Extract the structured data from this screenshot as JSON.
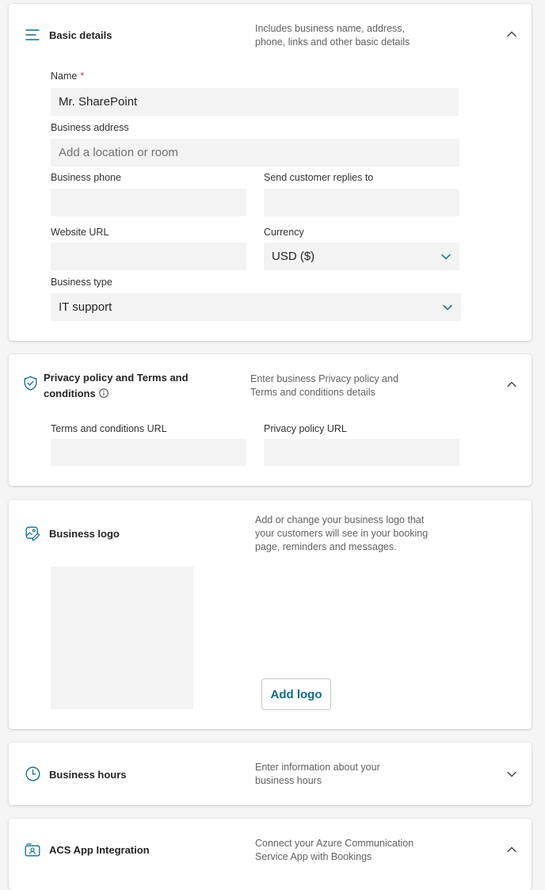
{
  "basic": {
    "title": "Basic details",
    "description": "Includes business name, address, phone, links and other basic details",
    "name_label": "Name",
    "required_mark": "*",
    "name_value": "Mr. SharePoint",
    "address_label": "Business address",
    "address_placeholder": "Add a location or room",
    "phone_label": "Business phone",
    "phone_value": "",
    "replies_label": "Send customer replies to",
    "replies_value": "",
    "website_label": "Website URL",
    "website_value": "",
    "currency_label": "Currency",
    "currency_value": "USD ($)",
    "type_label": "Business type",
    "type_value": "IT support"
  },
  "privacy": {
    "title_line1": "Privacy policy and Terms and",
    "title_line2": "conditions",
    "description": "Enter business Privacy policy and Terms and conditions details",
    "terms_label": "Terms and conditions URL",
    "terms_value": "",
    "policy_label": "Privacy policy URL",
    "policy_value": ""
  },
  "logo": {
    "title": "Business logo",
    "description": "Add or change your business logo that your customers will see in your booking page, reminders and messages.",
    "add_button": "Add logo"
  },
  "hours": {
    "title": "Business hours",
    "description": "Enter information about your business hours"
  },
  "acs": {
    "title": "ACS App Integration",
    "description": "Connect your Azure Communication Service App with Bookings"
  },
  "colors": {
    "accent": "#0f6c8c",
    "required": "#c4314b",
    "field_bg": "#f3f3f3"
  },
  "icons": {
    "basic": "lines-icon",
    "privacy": "shield-check-icon",
    "logo": "image-edit-icon",
    "hours": "clock-icon",
    "acs": "app-integration-icon",
    "expand": "chevron-up-icon",
    "collapse": "chevron-down-icon",
    "info": "info-icon"
  }
}
